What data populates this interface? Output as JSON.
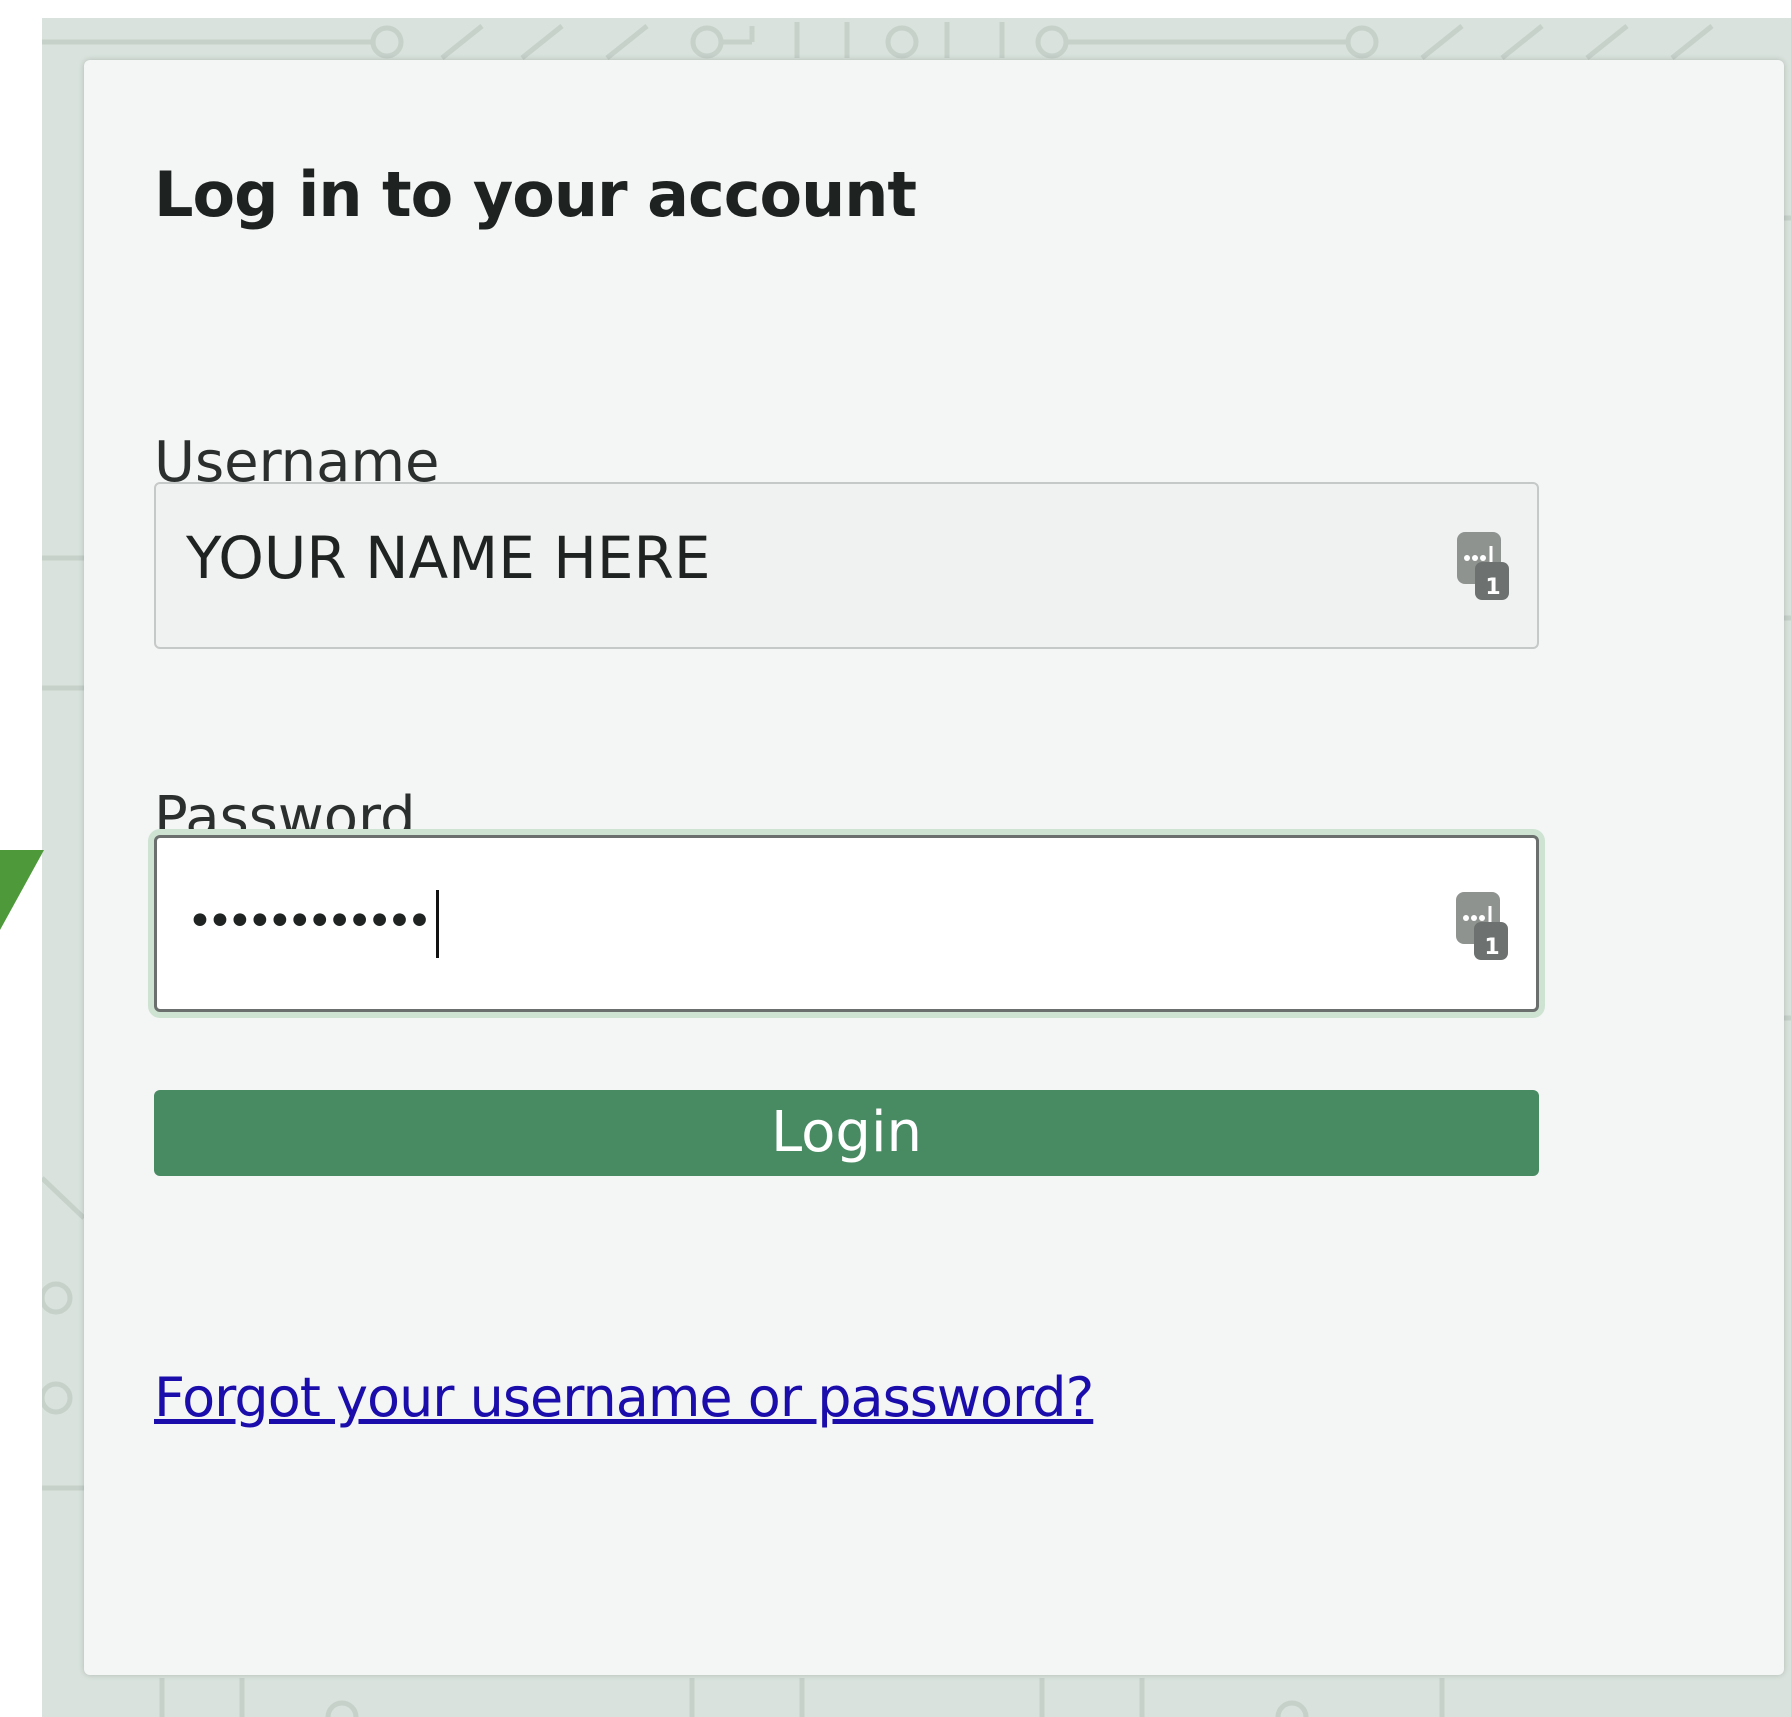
{
  "login": {
    "title": "Log in to your account",
    "username_label": "Username",
    "username_value": "YOUR NAME HERE",
    "password_label": "Password",
    "password_masked": "••••••••••••",
    "login_button": "Login",
    "forgot_link": "Forgot your username or password?"
  },
  "icons": {
    "field_icon": "password-manager-key-icon"
  },
  "colors": {
    "accent": "#488b63",
    "background_pattern": "#d9e2dc",
    "card": "#f4f6f5",
    "link": "#1a0dab",
    "focus_ring": "#cfe3d3"
  }
}
